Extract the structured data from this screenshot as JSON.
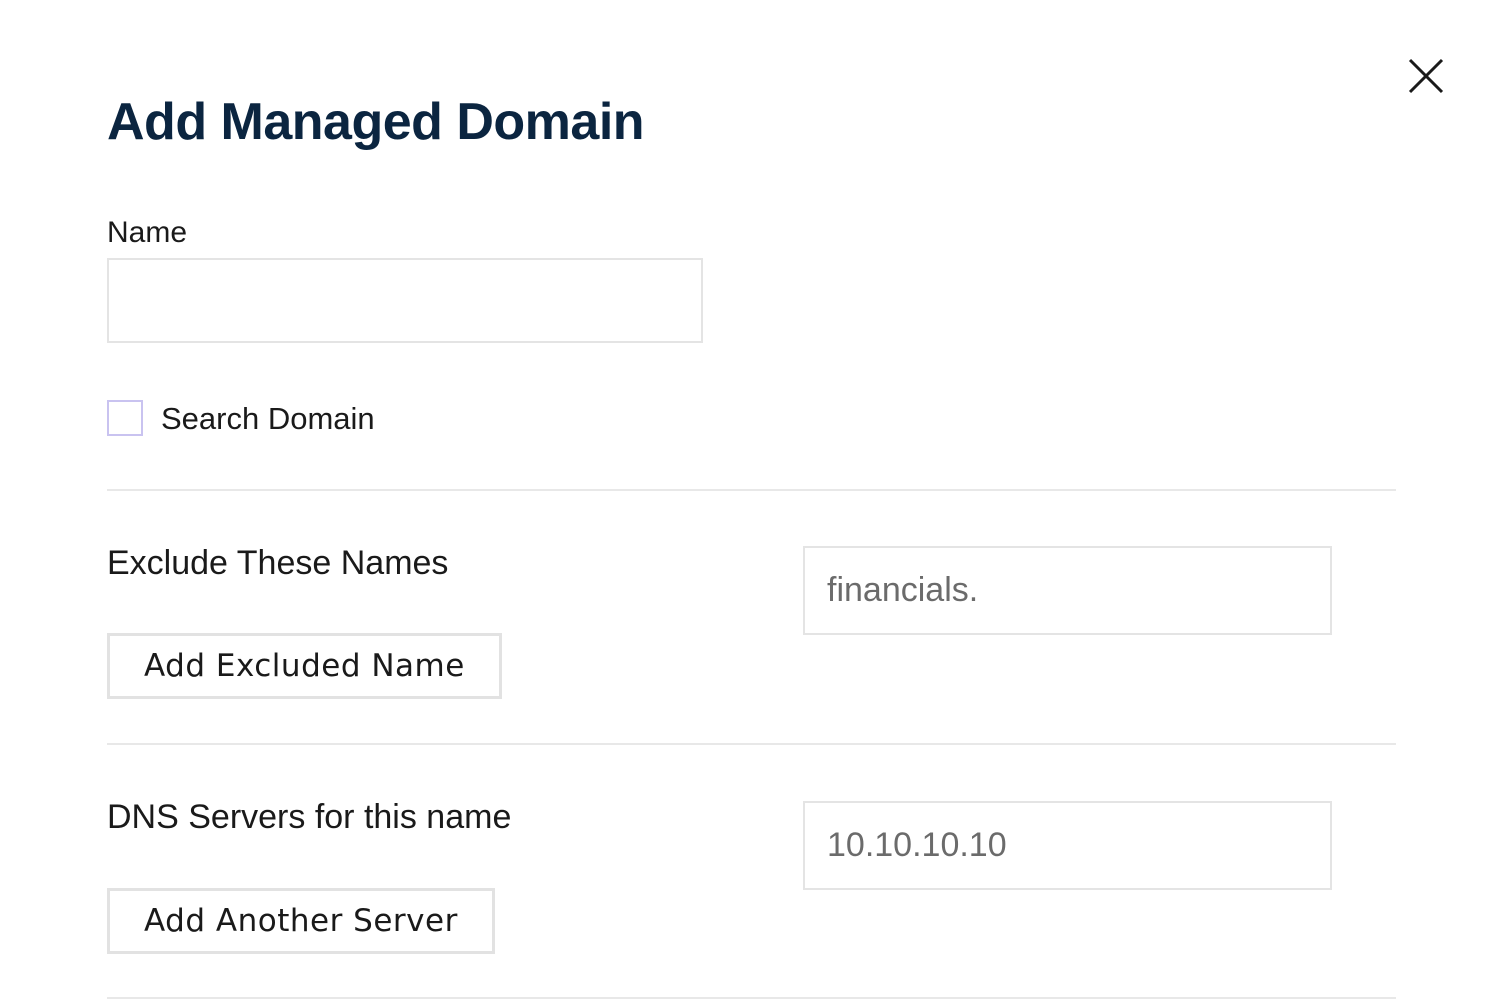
{
  "dialog": {
    "title": "Add Managed Domain",
    "close_icon": "close-icon"
  },
  "name_field": {
    "label": "Name",
    "value": "",
    "placeholder": ""
  },
  "search_domain": {
    "label": "Search Domain",
    "checked": false
  },
  "exclude_section": {
    "label": "Exclude These Names",
    "button_label": "Add Excluded Name",
    "input_placeholder": "financials.",
    "input_value": ""
  },
  "dns_section": {
    "label": "DNS Servers for this name",
    "button_label": "Add Another Server",
    "input_placeholder": "10.10.10.10",
    "input_value": ""
  },
  "colors": {
    "title": "#0b2540",
    "checkbox_border": "#c9c3f0",
    "divider": "#e8e8e8",
    "input_border": "#e4e4e4"
  }
}
